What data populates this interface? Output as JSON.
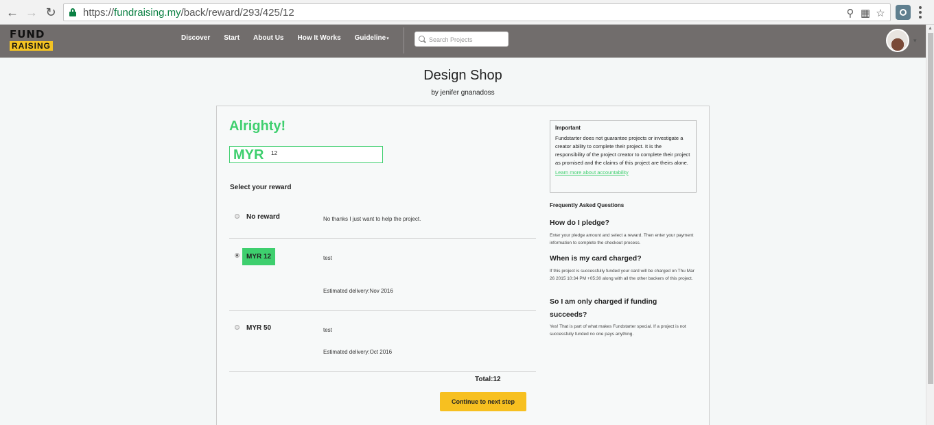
{
  "browser": {
    "url_scheme": "https://",
    "url_host": "fundraising.my",
    "url_path": "/back/reward/293/425/12"
  },
  "site": {
    "logo_line1": "FUND",
    "logo_line2": "RAISING",
    "nav": [
      "Discover",
      "Start",
      "About Us",
      "How It Works",
      "Guideline"
    ],
    "search_placeholder": "Search Projects"
  },
  "project": {
    "title": "Design Shop",
    "by": "by jenifer gnanadoss"
  },
  "pledge": {
    "heading": "Alrighty!",
    "currency": "MYR",
    "amount": "12",
    "select_label": "Select your reward"
  },
  "rewards": [
    {
      "name": "No reward",
      "description": "No thanks I just want to help the project.",
      "delivery": "",
      "selected": false
    },
    {
      "name": "MYR 12",
      "description": "test",
      "delivery": "Estimated delivery:Nov 2016",
      "selected": true
    },
    {
      "name": "MYR 50",
      "description": "test",
      "delivery": "Estimated delivery:Oct 2016",
      "selected": false
    }
  ],
  "total": "Total:12",
  "continue_label": "Continue to next step",
  "important": {
    "heading": "Important",
    "text": "Fundstarter does not guarantee projects or investigate a creator ability to complete their project. It is the responsibility of the project creator to complete their project as promised and the claims of this project are theirs alone.",
    "link": "Learn more about accountability"
  },
  "faq": {
    "heading": "Frequently Asked Questions",
    "items": [
      {
        "q": "How do I pledge?",
        "a": "Enter your pledge amount and select a reward. Then enter your payment information to complete the checkout process."
      },
      {
        "q": "When is my card charged?",
        "a": "If this project is successfully funded your card will be charged on Thu Mar 26 2015 10:34 PM +05:30 along with all the other backers of this project."
      },
      {
        "q": "So I am only charged if funding succeeds?",
        "a": "Yes! That is part of what makes Fundstarter special. If a project is not successfully funded no one pays anything."
      }
    ]
  },
  "colors": {
    "accent_green": "#3ecf6e",
    "button_yellow": "#f7c020",
    "header_gray": "#716d6c"
  },
  "icons": [
    "back-arrow-icon",
    "forward-arrow-icon",
    "reload-icon",
    "lock-icon",
    "zoom-icon",
    "translate-icon",
    "star-icon",
    "extension-icon",
    "menu-icon",
    "search-icon"
  ]
}
